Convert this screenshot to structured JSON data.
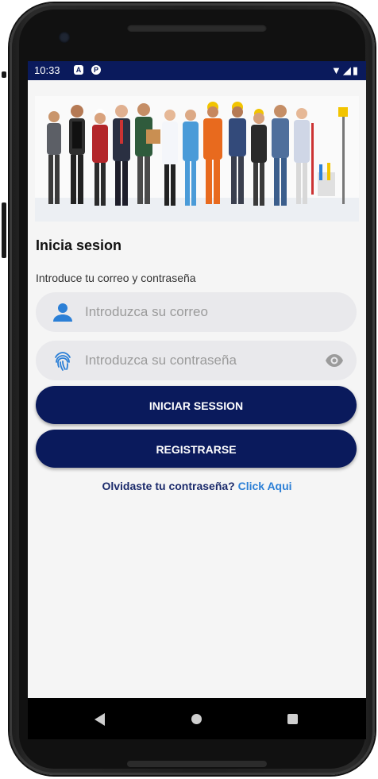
{
  "statusbar": {
    "time": "10:33",
    "icon1": "A",
    "icon2": "P",
    "right_icons": "▼◢▮"
  },
  "hero": {
    "image_semantic": "group-of-professionals-photo"
  },
  "login": {
    "title": "Inicia sesion",
    "subtitle": "Introduce tu correo y contraseña",
    "email_placeholder": "Introduzca su correo",
    "password_placeholder": "Introduzca su contraseña",
    "login_button": "INICIAR SESSION",
    "register_button": "REGISTRARSE",
    "forgot_text": "Olvidaste tu contraseña?",
    "forgot_link": "Click Aqui"
  },
  "colors": {
    "primary": "#0a1a5c",
    "accent": "#2b7fd6",
    "field_bg": "#e9e9ec",
    "screen_bg": "#f5f5f5"
  },
  "icons": {
    "email": "person-icon",
    "password": "fingerprint-icon",
    "toggle": "eye-icon"
  }
}
